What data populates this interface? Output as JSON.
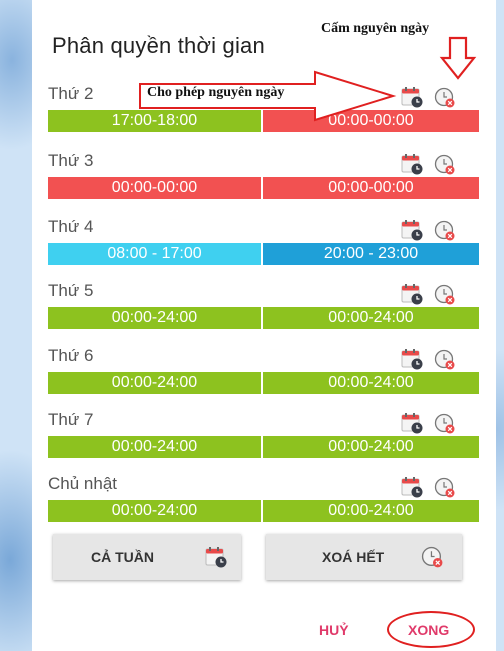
{
  "dialog": {
    "title": "Phân quyền thời gian"
  },
  "days": [
    {
      "label": "Thứ 2",
      "slots": [
        {
          "text": "17:00-18:00",
          "color": "#8dc21f"
        },
        {
          "text": "00:00-00:00",
          "color": "#f25151"
        }
      ]
    },
    {
      "label": "Thứ 3",
      "slots": [
        {
          "text": "00:00-00:00",
          "color": "#f25151"
        },
        {
          "text": "00:00-00:00",
          "color": "#f25151"
        }
      ]
    },
    {
      "label": "Thứ 4",
      "slots": [
        {
          "text": "08:00 - 17:00",
          "color": "#3fd0f0"
        },
        {
          "text": "20:00 - 23:00",
          "color": "#1fa0d8"
        }
      ]
    },
    {
      "label": "Thứ 5",
      "slots": [
        {
          "text": "00:00-24:00",
          "color": "#8dc21f"
        },
        {
          "text": "00:00-24:00",
          "color": "#8dc21f"
        }
      ]
    },
    {
      "label": "Thứ 6",
      "slots": [
        {
          "text": "00:00-24:00",
          "color": "#8dc21f"
        },
        {
          "text": "00:00-24:00",
          "color": "#8dc21f"
        }
      ]
    },
    {
      "label": "Thứ 7",
      "slots": [
        {
          "text": "00:00-24:00",
          "color": "#8dc21f"
        },
        {
          "text": "00:00-24:00",
          "color": "#8dc21f"
        }
      ]
    },
    {
      "label": "Chủ nhật",
      "slots": [
        {
          "text": "00:00-24:00",
          "color": "#8dc21f"
        },
        {
          "text": "00:00-24:00",
          "color": "#8dc21f"
        }
      ]
    }
  ],
  "actions": {
    "whole_week_label": "CẢ TUẦN",
    "clear_all_label": "XOÁ HẾT"
  },
  "footer": {
    "cancel_label": "HUỶ",
    "done_label": "XONG"
  },
  "annotations": {
    "block_whole_day": "Cấm nguyên ngày",
    "allow_whole_day": "Cho phép nguyên ngày"
  },
  "icons": {
    "allow_day": "calendar-clock-icon",
    "block_day": "clock-block-icon"
  },
  "colors": {
    "accent": "#e03a6a",
    "annotation": "#e02020"
  }
}
